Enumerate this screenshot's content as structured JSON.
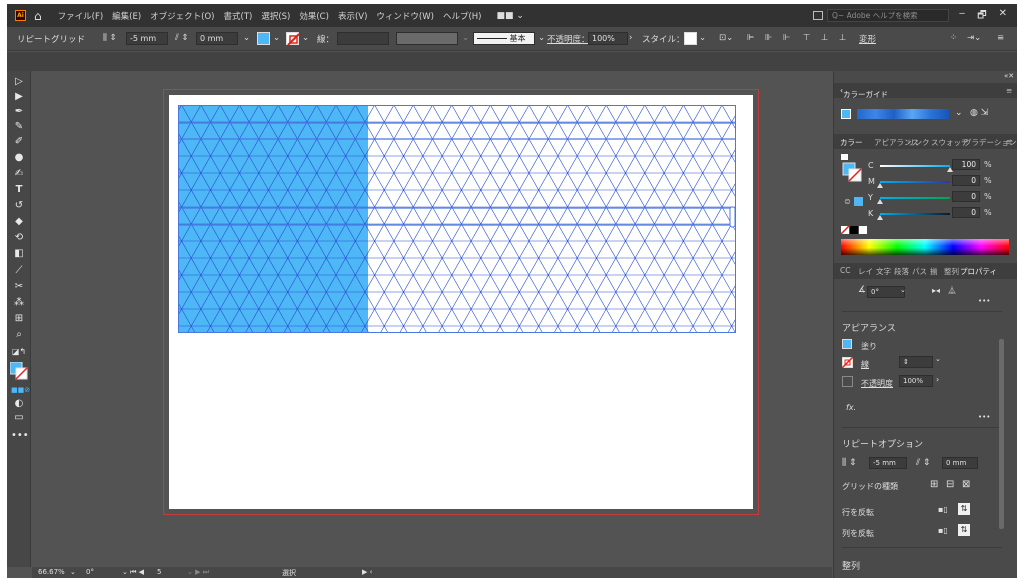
{
  "menubar": {
    "logo": "Ai",
    "items": [
      "ファイル(F)",
      "編集(E)",
      "オブジェクト(O)",
      "書式(T)",
      "選択(S)",
      "効果(C)",
      "表示(V)",
      "ウィンドウ(W)",
      "ヘルプ(H)"
    ],
    "workspace_icon": "■■ ⌄",
    "search_placeholder": "Q~ Adobe ヘルプを検索",
    "window_controls": [
      "‒",
      "🗗",
      "✕"
    ]
  },
  "controlbar": {
    "selection_label": "リピートグリッド",
    "h_spacing": "-5 mm",
    "v_spacing": "0 mm",
    "fill_color": "#4db8f5",
    "stroke_label": "線：",
    "stroke_value": "",
    "brush_label": "基本",
    "opacity_label": "不透明度：",
    "opacity_value": "100%",
    "style_label": "スタイル：",
    "shape_label": "変形"
  },
  "canvas": {
    "fill_color": "#4db8f5",
    "grid_color": "#2a4fd6"
  },
  "status": {
    "zoom": "66.67%",
    "rotation": "0°",
    "artboard": "5",
    "mode": "選択"
  },
  "panels": {
    "color_guide_title": "カラーガイド",
    "color_tabs": [
      "カラー",
      "アピアランス",
      "リンク",
      "スウォッチ",
      "グラデーション"
    ],
    "cmyk": [
      {
        "channel": "C",
        "value": "100",
        "unit": "%",
        "color": "#00aeef"
      },
      {
        "channel": "M",
        "value": "0",
        "unit": "%",
        "color": "#ec008c"
      },
      {
        "channel": "Y",
        "value": "0",
        "unit": "%",
        "color": "#fff200"
      },
      {
        "channel": "K",
        "value": "0",
        "unit": "%",
        "color": "#000000"
      }
    ],
    "prop_tabs": [
      "CC",
      "レイ",
      "文字",
      "段落",
      "パス",
      "揃",
      "整列",
      "プロパティ"
    ],
    "rotate_value": "0°",
    "appearance_title": "アピアランス",
    "fill_label": "塗り",
    "stroke_label": "線",
    "opacity_label": "不透明度",
    "opacity_value": "100%",
    "fx_label": "fx.",
    "repeat_title": "リピートオプション",
    "repeat_h": "-5 mm",
    "repeat_v": "0 mm",
    "grid_type_label": "グリッドの種類",
    "flip_row_label": "行を反転",
    "flip_col_label": "列を反転",
    "align_title": "整列",
    "more": "•••"
  },
  "tools": [
    "selection-tool",
    "direct-selection-tool",
    "pen-tool",
    "curvature-tool",
    "anchor-tool",
    "ellipse-tool",
    "paintbrush-tool",
    "type-tool",
    "rotate-tool",
    "eraser-tool",
    "shaper-tool",
    "rectangle-tool",
    "eyedropper-tool",
    "blend-tool",
    "symbol-sprayer-tool",
    "artboard-tool",
    "zoom-tool"
  ]
}
